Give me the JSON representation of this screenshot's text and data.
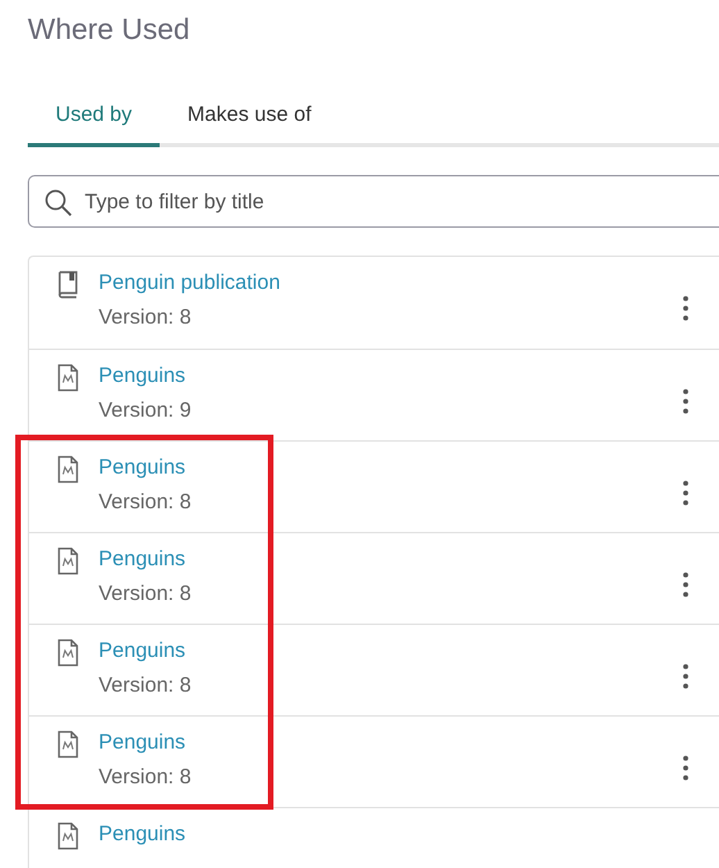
{
  "title": "Where Used",
  "tabs": [
    {
      "label": "Used by",
      "selected": true
    },
    {
      "label": "Makes use of",
      "selected": false
    }
  ],
  "search": {
    "placeholder": "Type to filter by title"
  },
  "items": [
    {
      "kind": "publication",
      "title": "Penguin publication",
      "version": "Version: 8",
      "highlighted": false
    },
    {
      "kind": "map",
      "title": "Penguins",
      "version": "Version: 9",
      "highlighted": false
    },
    {
      "kind": "map",
      "title": "Penguins",
      "version": "Version: 8",
      "highlighted": true
    },
    {
      "kind": "map",
      "title": "Penguins",
      "version": "Version: 8",
      "highlighted": true
    },
    {
      "kind": "map",
      "title": "Penguins",
      "version": "Version: 8",
      "highlighted": true
    },
    {
      "kind": "map",
      "title": "Penguins",
      "version": "Version: 8",
      "highlighted": true
    },
    {
      "kind": "map",
      "title": "Penguins",
      "highlighted": false
    }
  ]
}
